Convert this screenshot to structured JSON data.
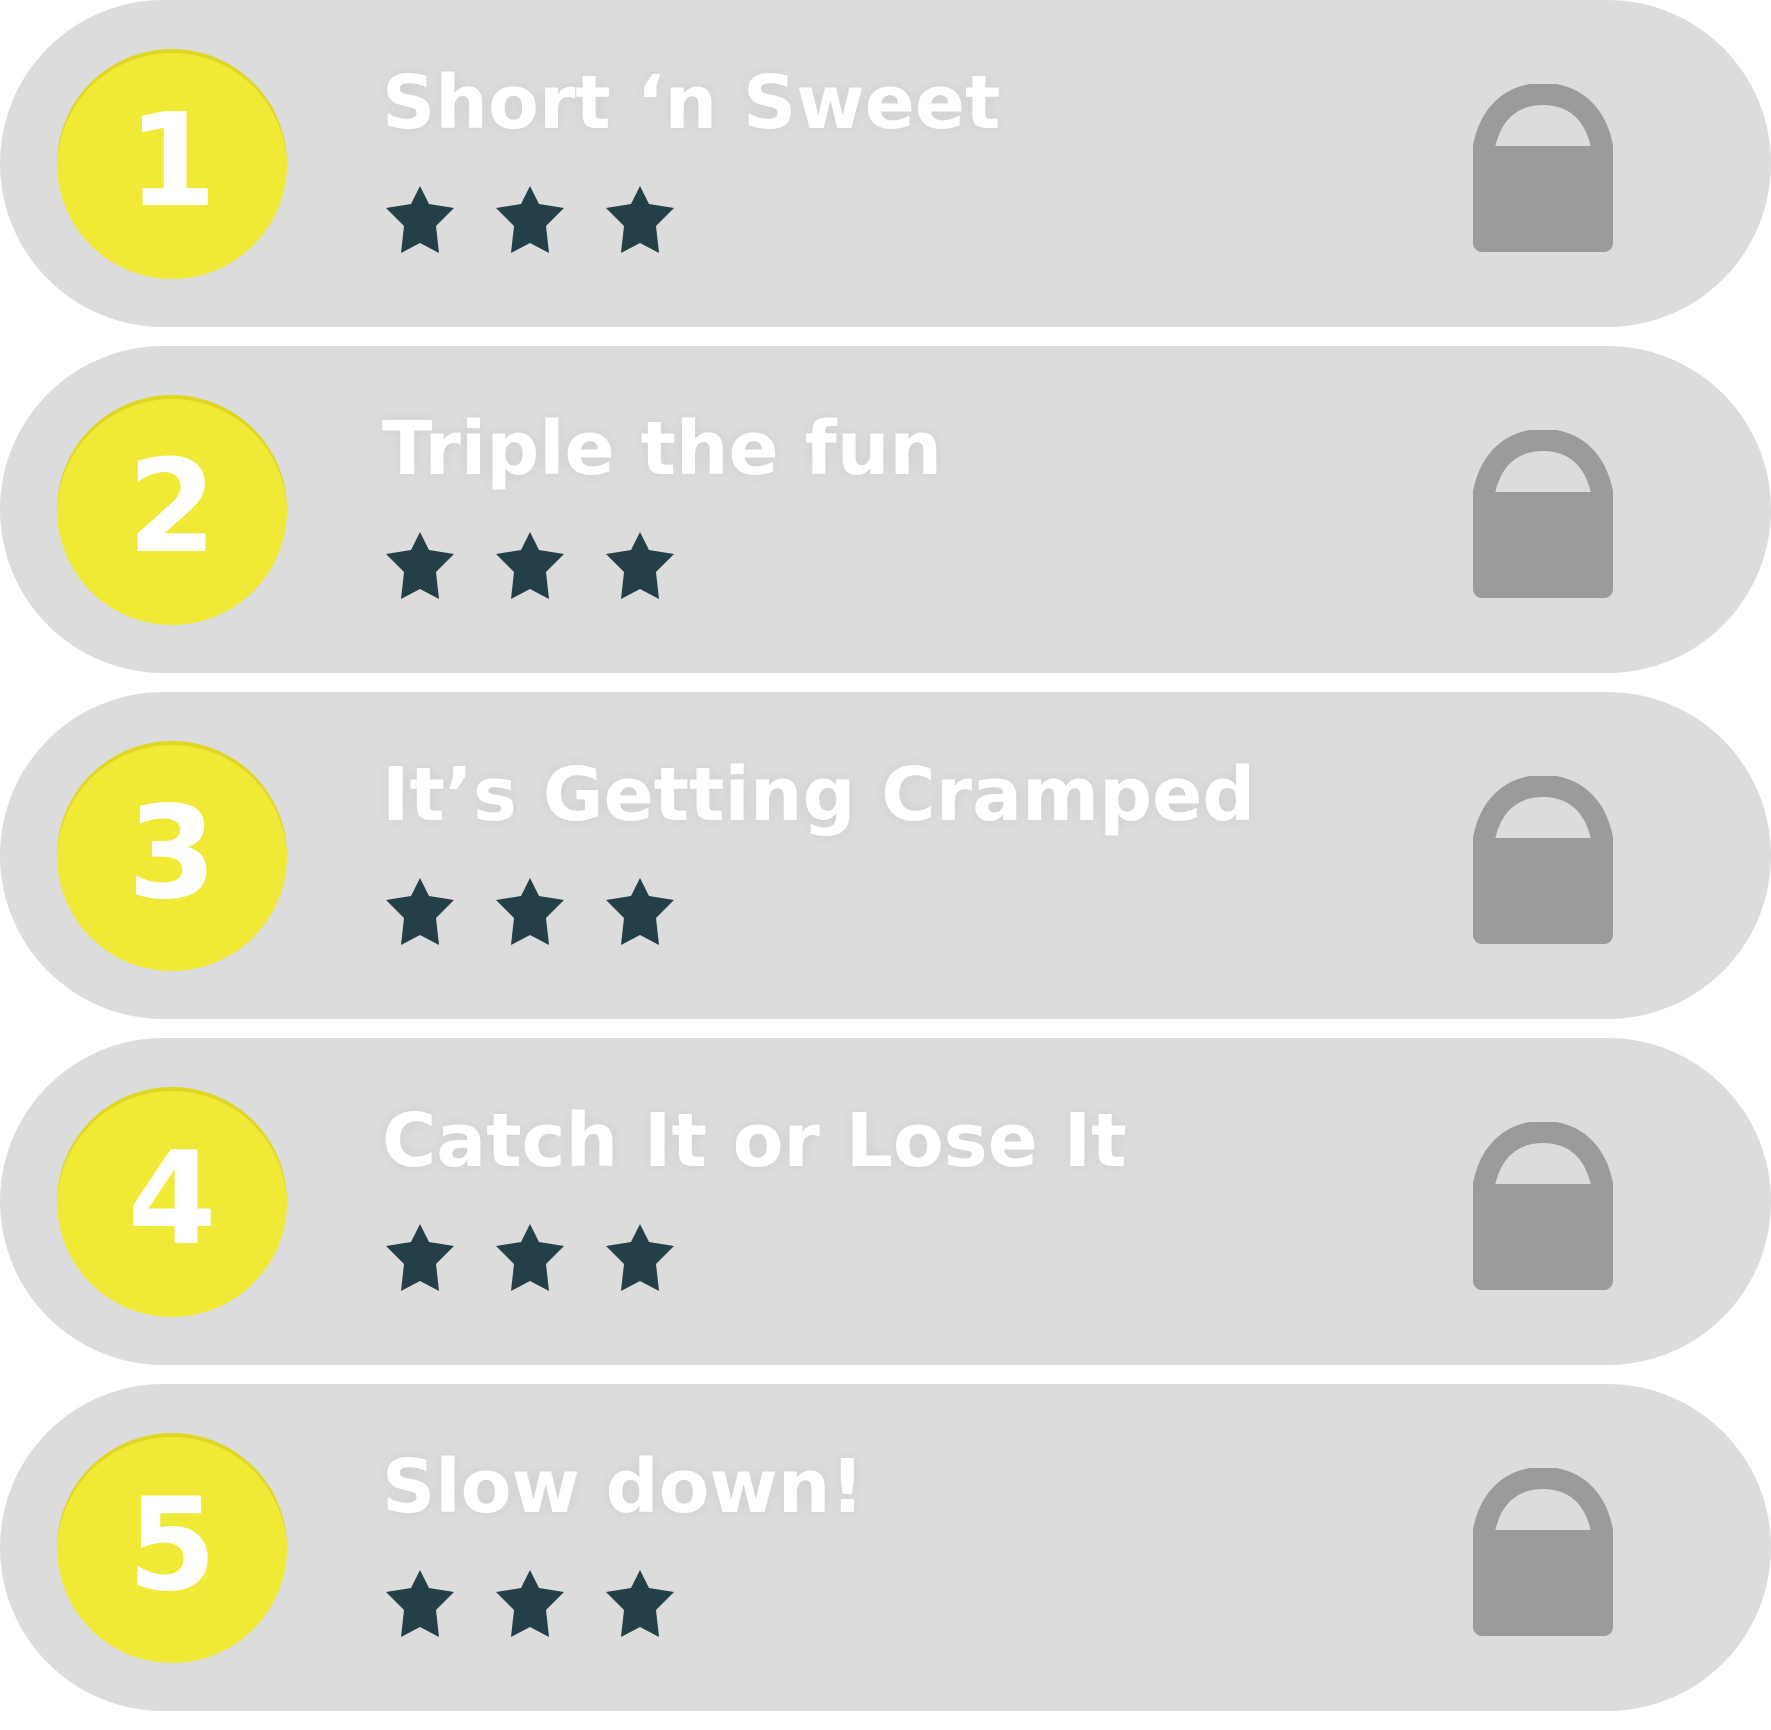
{
  "levels": [
    {
      "number": "1",
      "title": "Short ‘n Sweet",
      "stars_earned": 3,
      "stars_total": 3,
      "locked": true
    },
    {
      "number": "2",
      "title": "Triple the fun",
      "stars_earned": 3,
      "stars_total": 3,
      "locked": true
    },
    {
      "number": "3",
      "title": "It’s Getting Cramped",
      "stars_earned": 3,
      "stars_total": 3,
      "locked": true
    },
    {
      "number": "4",
      "title": "Catch It or Lose It",
      "stars_earned": 3,
      "stars_total": 3,
      "locked": true
    },
    {
      "number": "5",
      "title": "Slow down!",
      "stars_earned": 3,
      "stars_total": 3,
      "locked": true
    }
  ],
  "icons": {
    "star": "star-icon",
    "lock": "lock-icon"
  },
  "colors": {
    "row_background": "#dcdcdc",
    "badge": "#f0e935",
    "text": "#ffffff",
    "star": "#253f48",
    "lock": "#9b9b9b"
  }
}
